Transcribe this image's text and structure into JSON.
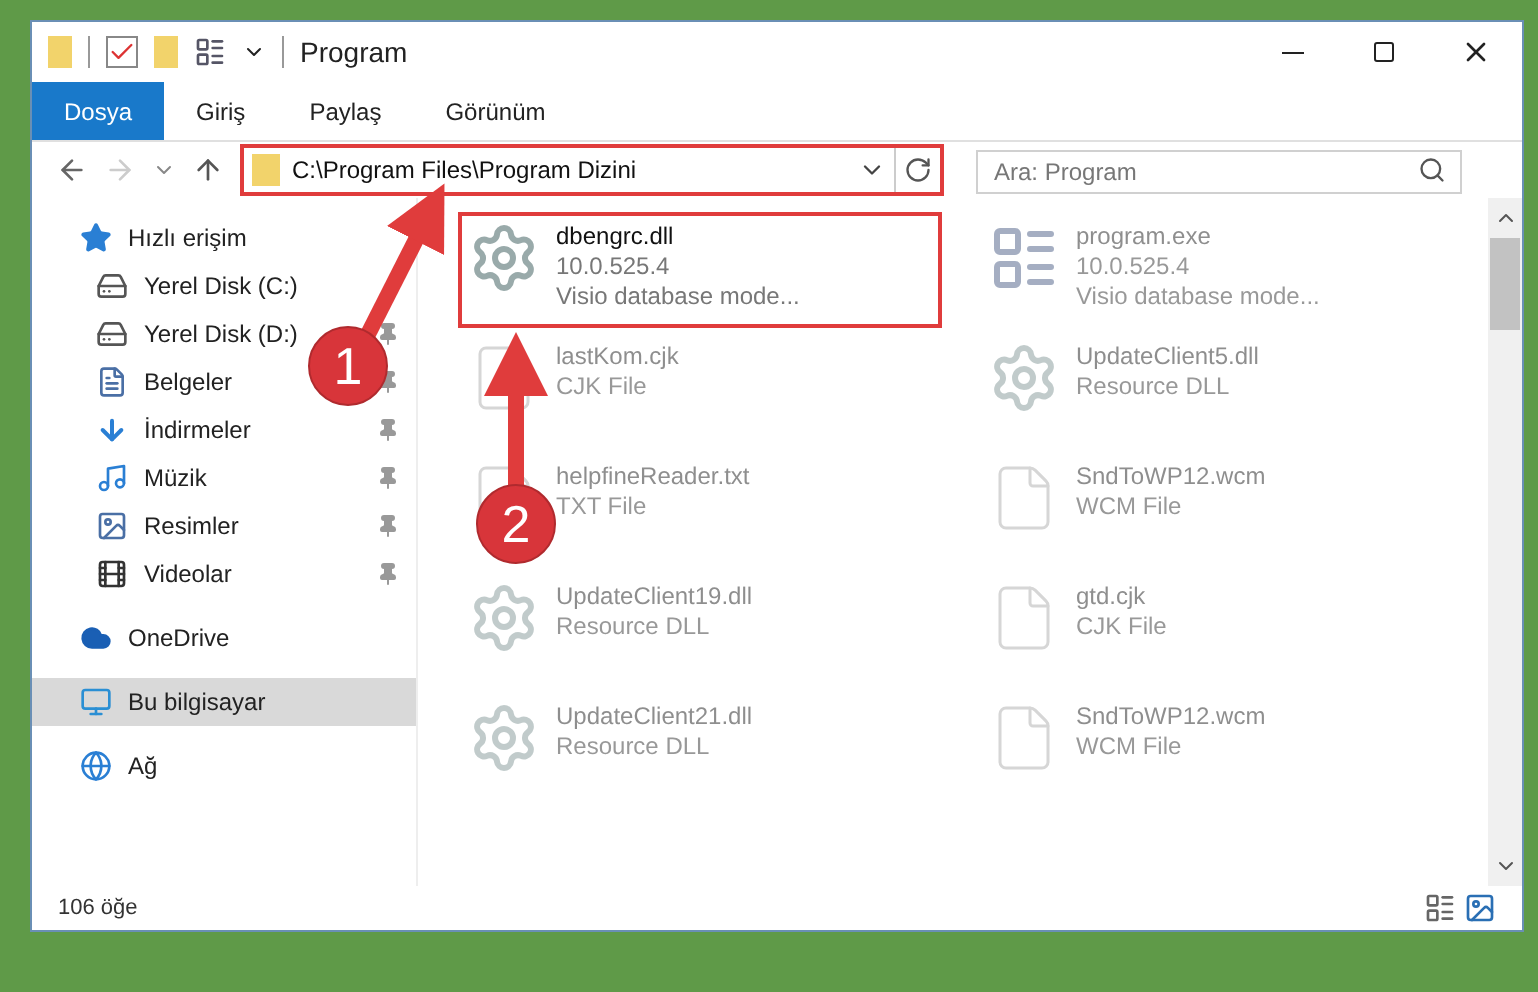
{
  "window": {
    "title": "Program"
  },
  "ribbon_tabs": [
    {
      "label": "Dosya",
      "kind": "file"
    },
    {
      "label": "Giriş",
      "kind": "tab"
    },
    {
      "label": "Paylaş",
      "kind": "tab"
    },
    {
      "label": "Görünüm",
      "kind": "tab"
    }
  ],
  "address_bar": {
    "path": "C:\\Program Files\\Program Dizini"
  },
  "search": {
    "placeholder": "Ara: Program"
  },
  "sidebar": {
    "items": [
      {
        "label": "Hızlı erişim",
        "kind": "star",
        "selected": false,
        "children": [
          {
            "label": "Yerel Disk (C:)",
            "kind": "drive",
            "pinned": false
          },
          {
            "label": "Yerel Disk (D:)",
            "kind": "drive",
            "pinned": true
          },
          {
            "label": "Belgeler",
            "kind": "documents",
            "pinned": true
          },
          {
            "label": "İndirmeler",
            "kind": "downloads",
            "pinned": true
          },
          {
            "label": "Müzik",
            "kind": "music",
            "pinned": true
          },
          {
            "label": "Resimler",
            "kind": "pictures",
            "pinned": true
          },
          {
            "label": "Videolar",
            "kind": "videos",
            "pinned": true
          }
        ]
      },
      {
        "label": "OneDrive",
        "kind": "cloud",
        "selected": false
      },
      {
        "label": "Bu bilgisayar",
        "kind": "computer",
        "selected": true
      },
      {
        "label": "Ağ",
        "kind": "network",
        "selected": false
      }
    ]
  },
  "files": [
    {
      "name": "dbengrc.dll",
      "details": [
        "10.0.525.4",
        "Visio database mode..."
      ],
      "kind": "dll",
      "dimmed": false
    },
    {
      "name": "program.exe",
      "details": [
        "10.0.525.4",
        "Visio database mode..."
      ],
      "kind": "exe",
      "dimmed": true
    },
    {
      "name": "lastKom.cjk",
      "details": [
        "CJK File"
      ],
      "kind": "file",
      "dimmed": true
    },
    {
      "name": "UpdateClient5.dll",
      "details": [
        "Resource DLL"
      ],
      "kind": "dll",
      "dimmed": true
    },
    {
      "name": "helpfineReader.txt",
      "details": [
        "TXT File"
      ],
      "kind": "file",
      "dimmed": true
    },
    {
      "name": "SndToWP12.wcm",
      "details": [
        "WCM File"
      ],
      "kind": "file",
      "dimmed": true
    },
    {
      "name": "UpdateClient19.dll",
      "details": [
        "Resource DLL"
      ],
      "kind": "dll",
      "dimmed": true
    },
    {
      "name": "gtd.cjk",
      "details": [
        "CJK File"
      ],
      "kind": "file",
      "dimmed": true
    },
    {
      "name": "UpdateClient21.dll",
      "details": [
        "Resource DLL"
      ],
      "kind": "dll",
      "dimmed": true
    },
    {
      "name": "SndToWP12.wcm",
      "details": [
        "WCM File"
      ],
      "kind": "file",
      "dimmed": true
    }
  ],
  "status_bar": {
    "item_count": "106 öğe"
  },
  "annotations": [
    {
      "label": "1"
    },
    {
      "label": "2"
    }
  ]
}
